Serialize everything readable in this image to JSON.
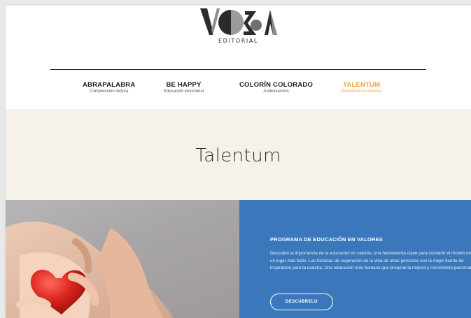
{
  "brand": {
    "logo_text": "VOSA",
    "subtitle": "EDITORIAL"
  },
  "nav": {
    "items": [
      {
        "title": "ABRAPALABRA",
        "subtitle": "Comprensión lectora",
        "active": false
      },
      {
        "title": "BE HAPPY",
        "subtitle": "Educación emocional",
        "active": false
      },
      {
        "title": "COLORÍN COLORADO",
        "subtitle": "Audiocuentos",
        "active": false
      },
      {
        "title": "TALENTUM",
        "subtitle": "Educación en valores",
        "active": true
      }
    ],
    "active_color": "#f3a23a"
  },
  "band": {
    "title": "Talentum",
    "background": "#f6f2ea"
  },
  "hero": {
    "panel_color": "#3b78bb",
    "heading": "PROGRAMA DE EDUCACIÓN EN VALORES",
    "body": "Descubre la importancia de la educación en valores, una herramienta clave para convertir el mundo en un lugar más bello. Las historias de superación de la vida de otras personas son la mejor fuente de inspiración para la nuestra. Una educación más humana que propone la mejora y crecimiento personal.",
    "button_label": "DESCÚBRELO",
    "image": "hands-holding-red-heart"
  }
}
